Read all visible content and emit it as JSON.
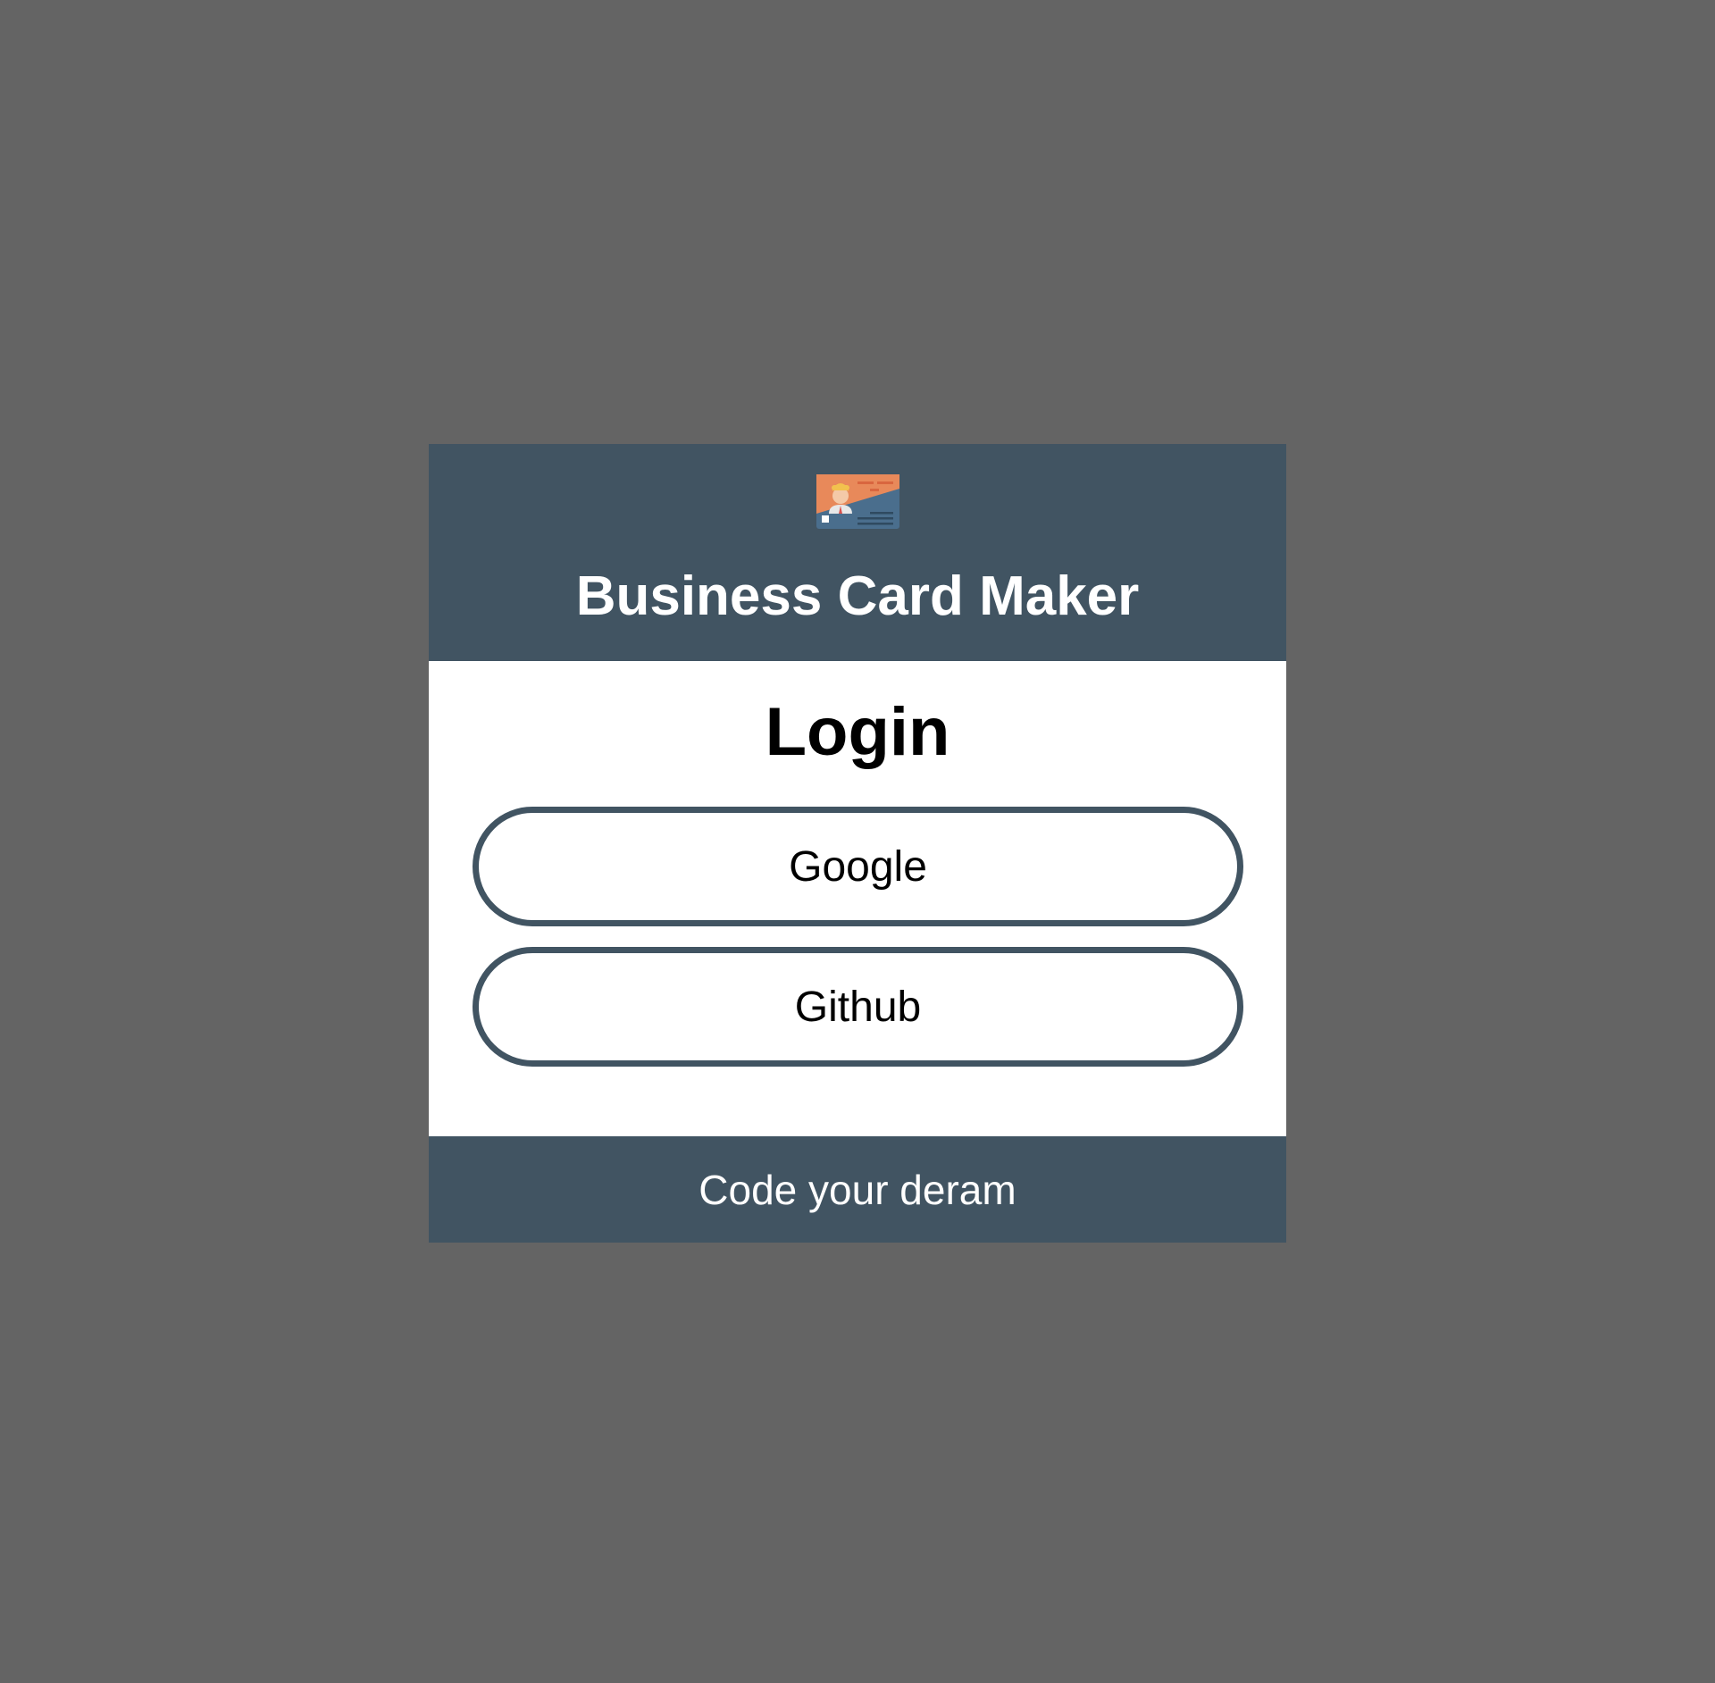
{
  "header": {
    "logo_icon": "business-card-icon",
    "title": "Business Card Maker"
  },
  "login": {
    "heading": "Login",
    "providers": [
      {
        "label": "Google"
      },
      {
        "label": "Github"
      }
    ]
  },
  "footer": {
    "text": "Code your deram"
  },
  "colors": {
    "page_background": "#646464",
    "header_footer_bg": "#415462",
    "card_bg": "#ffffff",
    "button_border": "#415462",
    "logo_orange": "#e8895a",
    "logo_blue": "#4a6e8d"
  }
}
